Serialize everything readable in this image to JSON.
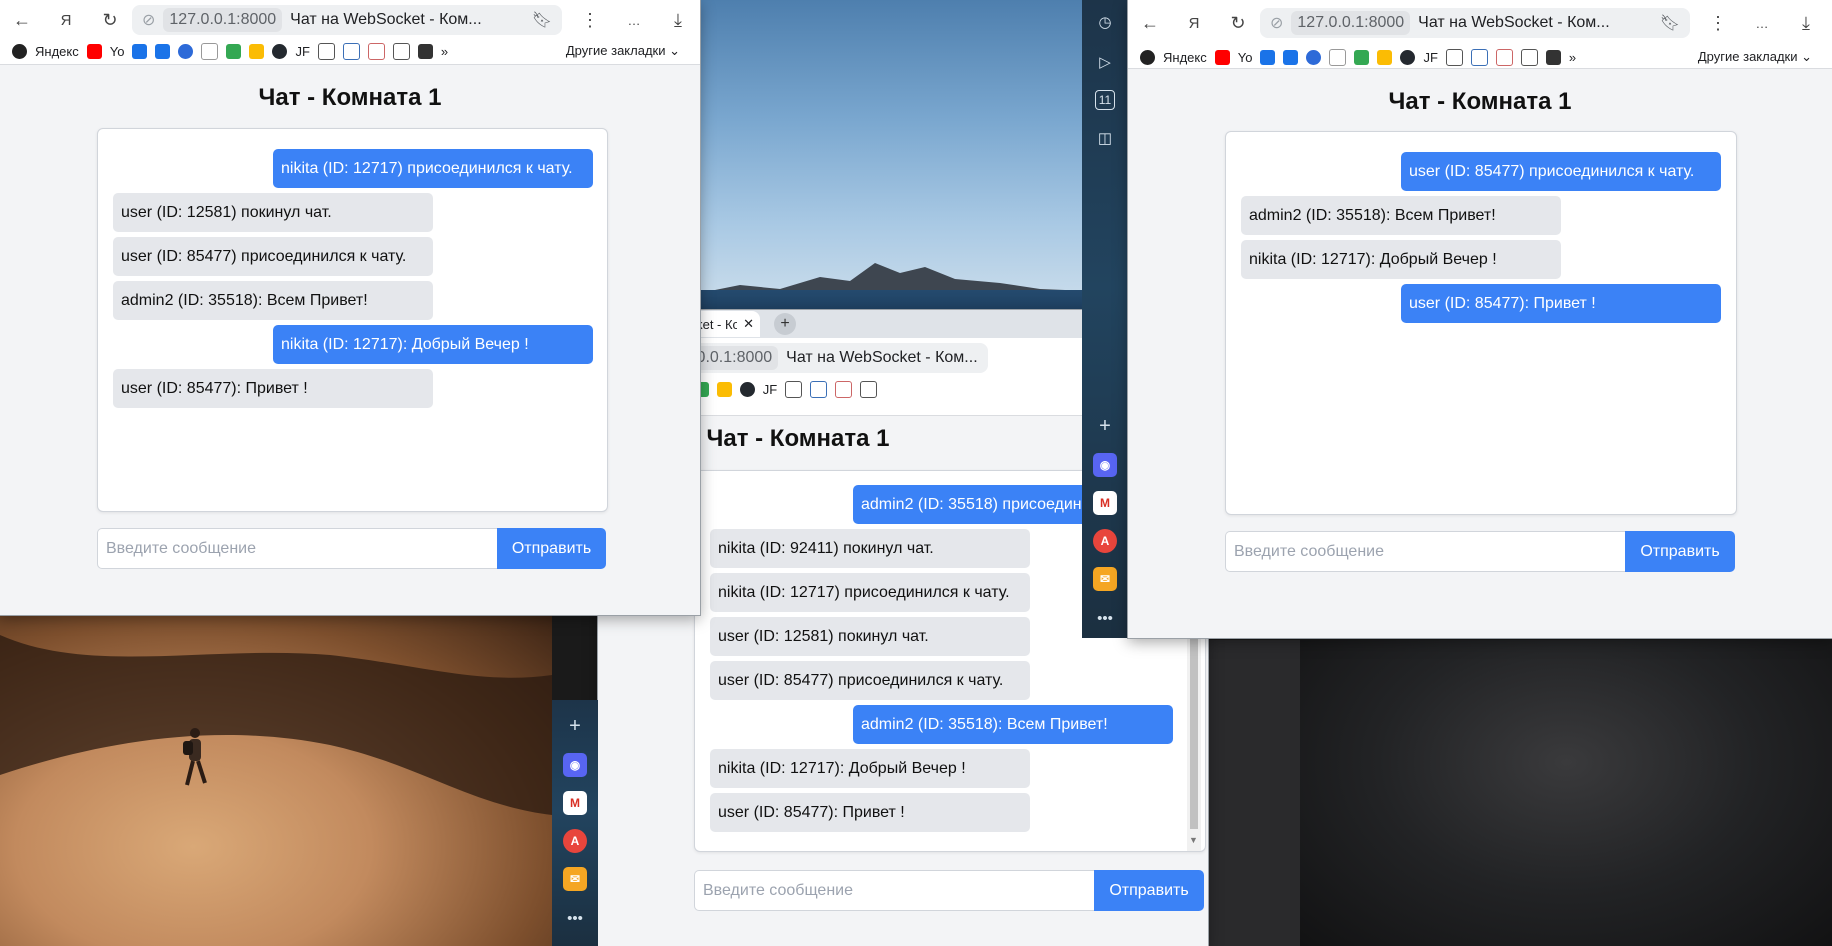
{
  "address": {
    "host": "127.0.0.1:8000",
    "title": "Чат на WebSocket - Ком..."
  },
  "tab": {
    "title": "Чат на WebSocket - Ком"
  },
  "bookmarks": {
    "yandex": "Яндекс",
    "youtube": "Yo",
    "jf": "JF",
    "other": "Другие закладки",
    "more": "»"
  },
  "chat": {
    "heading": "Чат - Комната 1",
    "placeholder": "Введите сообщение",
    "send_label": "Отправить"
  },
  "windows": {
    "left": {
      "messages": [
        {
          "text": "nikita (ID: 12717) присоединился к чату.",
          "own": true
        },
        {
          "text": "user (ID: 12581) покинул чат.",
          "own": false
        },
        {
          "text": "user (ID: 85477) присоединился к чату.",
          "own": false
        },
        {
          "text": "admin2 (ID: 35518): Всем Привет!",
          "own": false
        },
        {
          "text": "nikita (ID: 12717): Добрый Вечер !",
          "own": true
        },
        {
          "text": "user (ID: 85477): Привет !",
          "own": false
        }
      ]
    },
    "middle": {
      "messages": [
        {
          "text": "admin2 (ID: 35518) присоедини",
          "own": true
        },
        {
          "text": "nikita (ID: 92411) покинул чат.",
          "own": false
        },
        {
          "text": "nikita (ID: 12717) присоединился к чату.",
          "own": false
        },
        {
          "text": "user (ID: 12581) покинул чат.",
          "own": false
        },
        {
          "text": "user (ID: 85477) присоединился к чату.",
          "own": false
        },
        {
          "text": "admin2 (ID: 35518): Всем Привет!",
          "own": true
        },
        {
          "text": "nikita (ID: 12717): Добрый Вечер !",
          "own": false
        },
        {
          "text": "user (ID: 85477): Привет !",
          "own": false
        }
      ]
    },
    "right": {
      "messages": [
        {
          "text": "user (ID: 85477) присоединился к чату.",
          "own": true
        },
        {
          "text": "admin2 (ID: 35518): Всем Привет!",
          "own": false
        },
        {
          "text": "nikita (ID: 12717): Добрый Вечер !",
          "own": false
        },
        {
          "text": "user (ID: 85477): Привет !",
          "own": true
        }
      ]
    }
  },
  "sidebar": {
    "badge_number": "11"
  },
  "colors": {
    "accent": "#3b82f6",
    "bubble_other": "#e5e7eb",
    "page_bg": "#f3f4f6"
  }
}
